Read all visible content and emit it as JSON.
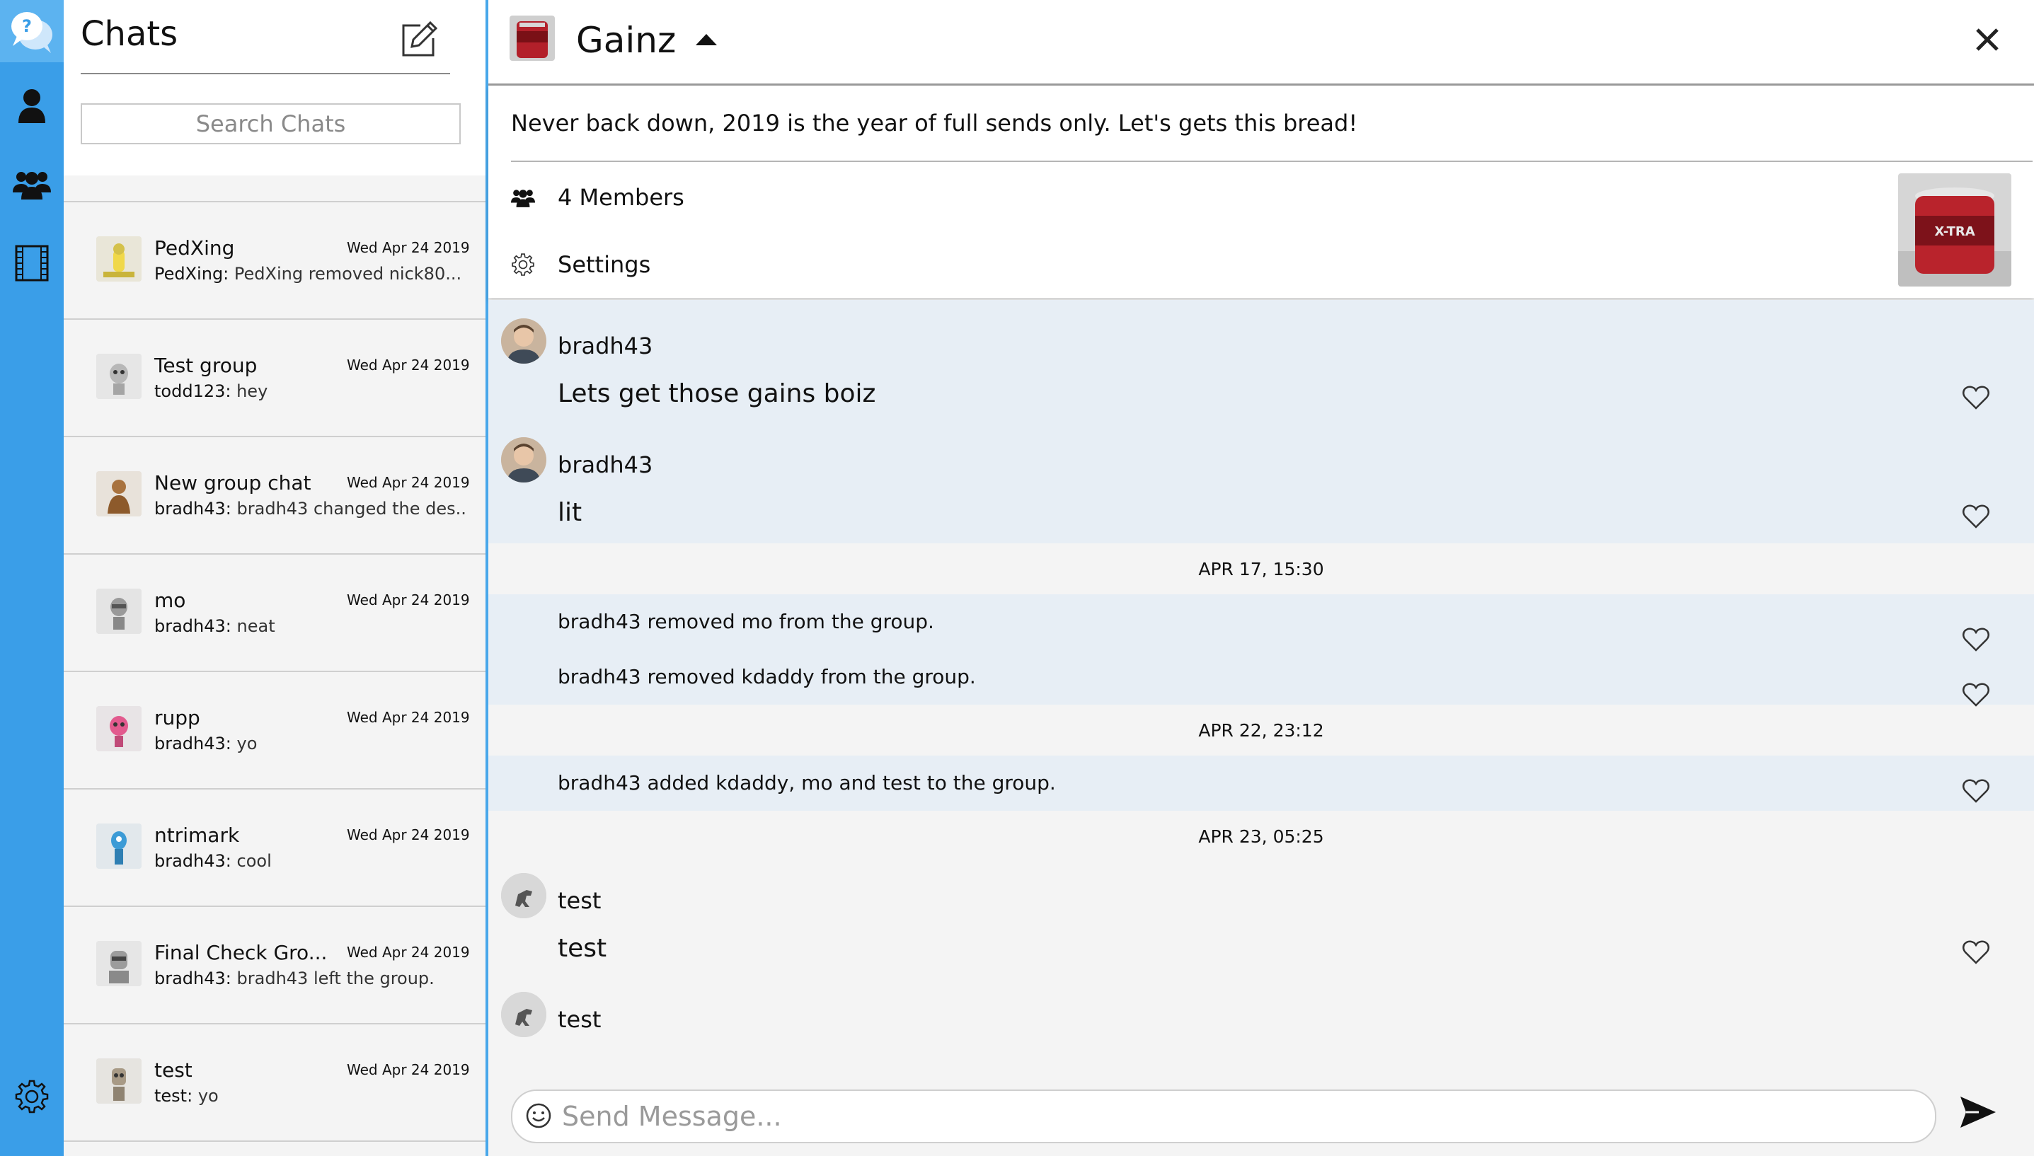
{
  "rail": {
    "items": [
      {
        "name": "help-chat-icon"
      },
      {
        "name": "person-icon"
      },
      {
        "name": "group-icon"
      },
      {
        "name": "film-icon"
      }
    ],
    "settings_icon": "gear-icon"
  },
  "sidebar": {
    "title": "Chats",
    "compose_icon": "compose-icon",
    "search_placeholder": "Search Chats",
    "chats": [
      {
        "name": "PedXing",
        "date": "Wed Apr 24 2019",
        "sender": "PedXing",
        "preview": " PedXing removed nick80..."
      },
      {
        "name": "Test group",
        "date": "Wed Apr 24 2019",
        "sender": "todd123",
        "preview": " hey"
      },
      {
        "name": "New group chat",
        "date": "Wed Apr 24 2019",
        "sender": "bradh43",
        "preview": " bradh43 changed the des..."
      },
      {
        "name": "mo",
        "date": "Wed Apr 24 2019",
        "sender": "bradh43",
        "preview": " neat"
      },
      {
        "name": "rupp",
        "date": "Wed Apr 24 2019",
        "sender": "bradh43",
        "preview": " yo"
      },
      {
        "name": "ntrimark",
        "date": "Wed Apr 24 2019",
        "sender": "bradh43",
        "preview": "  cool"
      },
      {
        "name": "Final Check Gro...",
        "date": "Wed Apr 24 2019",
        "sender": "bradh43",
        "preview": " bradh43 left the group."
      },
      {
        "name": "test",
        "date": "Wed Apr 24 2019",
        "sender": "test",
        "preview": " yo"
      }
    ]
  },
  "conversation": {
    "group_name": "Gainz",
    "description": "Never back down, 2019 is the year of full sends only. Let's gets this bread!",
    "members_label": "4 Members",
    "settings_label": "Settings",
    "messages": [
      {
        "author": "bradh43",
        "text": "Lets get those gains boiz"
      },
      {
        "author": "bradh43",
        "text": "lit"
      }
    ],
    "date_separators": [
      "APR 17, 15:30",
      "APR 22, 23:12",
      "APR 23, 05:25"
    ],
    "system_messages": [
      "bradh43 removed mo from the group.",
      "bradh43 removed kdaddy from the group.",
      "bradh43 added kdaddy, mo and test to the group."
    ],
    "later_messages": [
      {
        "author": "test",
        "text": "test"
      },
      {
        "author": "test",
        "text": ""
      }
    ]
  },
  "composer": {
    "placeholder": "Send Message...",
    "value": ""
  },
  "colors": {
    "rail": "#3a9ee8",
    "bubble_bg": "#e7eef5",
    "panel_bg": "#f4f4f4"
  }
}
